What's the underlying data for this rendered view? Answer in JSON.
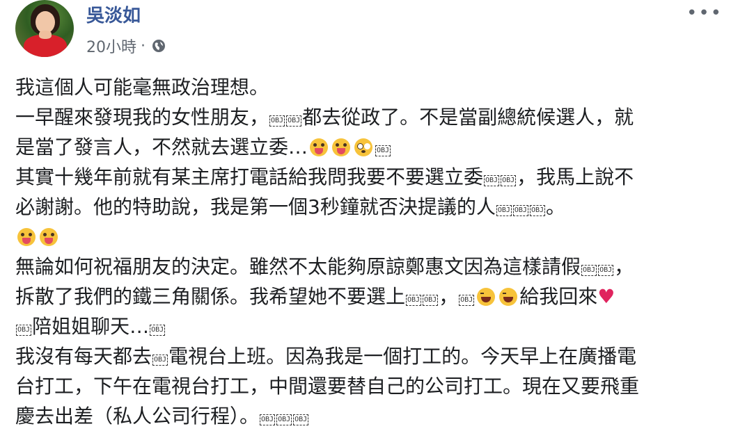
{
  "author": {
    "name": "吳淡如"
  },
  "meta": {
    "time": "20小時",
    "separator": "·"
  },
  "post": {
    "l1": "我這個人可能毫無政治理想。",
    "l2a": "一早醒來發現我的女性朋友，",
    "l2b": "都去從政了。不是當副總統候選人，就",
    "l3a": "是當了發言人，不然就去選立委…",
    "l4a": "其實十幾年前就有某主席打電話給我問我要不要選立委",
    "l4b": "，我馬上說不",
    "l5a": "必謝謝。他的特助說，我是第一個3秒鐘就否決提議的人",
    "l5b": "。",
    "l7a": "無論如何祝福朋友的決定。雖然不太能夠原諒鄭惠文因為這樣請假",
    "l7b": "，",
    "l8a": "拆散了我們的鐵三角關係。我希望她不要選上",
    "l8b": "，",
    "l8c": "給我回來",
    "l9a": "陪姐姐聊天…",
    "l10a": "我沒有每天都去",
    "l10b": "電視台上班。因為我是一個打工的。今天早上在廣播電",
    "l11": "台打工，下午在電視台打工，中間還要替自己的公司打工。現在又要飛重",
    "l12": "慶去出差（私人公司行程）。"
  },
  "placeholder_glyph": "OBJ",
  "icons": {
    "globe": "globe-icon",
    "more": "more-options-icon",
    "heart": "heart-icon",
    "tongue": "grinning-tongue-emoji",
    "flush": "flushed-face-emoji",
    "laugh": "laughing-face-emoji"
  },
  "colors": {
    "name": "#385898",
    "meta": "#606770",
    "text": "#1c1e21",
    "heart": "#e0245e"
  }
}
